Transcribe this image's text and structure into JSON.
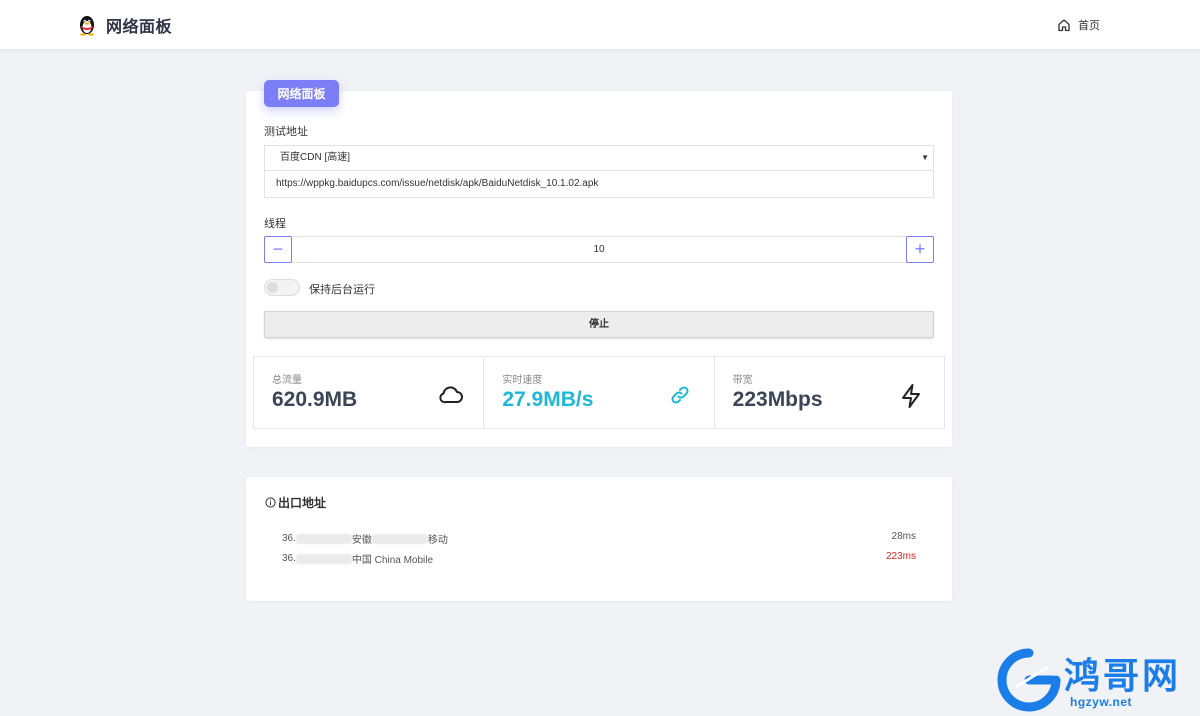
{
  "header": {
    "title": "网络面板",
    "nav_home": "首页"
  },
  "panel": {
    "badge": "网络面板",
    "test_address_label": "测试地址",
    "selected_source": "百度CDN [高速]",
    "url": "https://wppkg.baidupcs.com/issue/netdisk/apk/BaiduNetdisk_10.1.02.apk",
    "threads_label": "线程",
    "threads_value": "10",
    "minus": "−",
    "plus": "+",
    "background_label": "保持后台运行",
    "background_on": false,
    "stop_button": "停止"
  },
  "stats": [
    {
      "label": "总流量",
      "value": "620.9MB",
      "icon": "cloud-icon"
    },
    {
      "label": "实时速度",
      "value": "27.9MB/s",
      "icon": "link-icon"
    },
    {
      "label": "带宽",
      "value": "223Mbps",
      "icon": "bolt-icon"
    }
  ],
  "egress": {
    "title": "出口地址",
    "rows": [
      {
        "ip_prefix": "36.",
        "location": "安徽",
        "isp": "移动",
        "latency": "28ms"
      },
      {
        "ip_prefix": "36.",
        "location": "中国 China Mobile",
        "isp": "",
        "latency": "223ms"
      }
    ]
  },
  "watermark": {
    "text": "鸿哥网",
    "sub": "hgzyw.net"
  },
  "colors": {
    "accent": "#7c7ef5",
    "speed": "#1fb7d6",
    "latency_bad": "#e02424",
    "watermark": "#1b7ee8"
  }
}
